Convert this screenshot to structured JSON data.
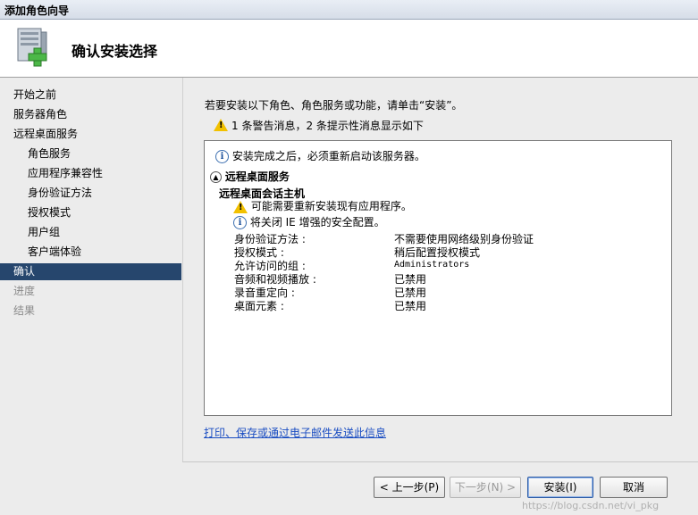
{
  "window": {
    "title": "添加角色向导"
  },
  "header": {
    "title": "确认安装选择",
    "icon": "server-add-icon"
  },
  "sidebar": {
    "items": [
      {
        "label": "开始之前",
        "level": 0,
        "state": "normal"
      },
      {
        "label": "服务器角色",
        "level": 0,
        "state": "normal"
      },
      {
        "label": "远程桌面服务",
        "level": 0,
        "state": "normal"
      },
      {
        "label": "角色服务",
        "level": 1,
        "state": "normal"
      },
      {
        "label": "应用程序兼容性",
        "level": 1,
        "state": "normal"
      },
      {
        "label": "身份验证方法",
        "level": 1,
        "state": "normal"
      },
      {
        "label": "授权模式",
        "level": 1,
        "state": "normal"
      },
      {
        "label": "用户组",
        "level": 1,
        "state": "normal"
      },
      {
        "label": "客户端体验",
        "level": 1,
        "state": "normal"
      },
      {
        "label": "确认",
        "level": 0,
        "state": "active"
      },
      {
        "label": "进度",
        "level": 0,
        "state": "disabled"
      },
      {
        "label": "结果",
        "level": 0,
        "state": "disabled"
      }
    ]
  },
  "main": {
    "intro": "若要安装以下角色、角色服务或功能，请单击“安装”。",
    "summary": "1 条警告消息，2 条提示性消息显示如下",
    "results": {
      "restart_info": "安装完成之后，必须重新启动该服务器。",
      "section_title": "远程桌面服务",
      "subsection_title": "远程桌面会话主机",
      "warning": "可能需要重新安装现有应用程序。",
      "ie_info": "将关闭 IE 增强的安全配置。",
      "settings": [
        {
          "key": "身份验证方法 :",
          "value": "不需要使用网络级别身份验证"
        },
        {
          "key": "授权模式 :",
          "value": "稍后配置授权模式"
        },
        {
          "key": "允许访问的组 :",
          "value": "Administrators"
        },
        {
          "key": "音频和视频播放 :",
          "value": "已禁用"
        },
        {
          "key": "录音重定向 :",
          "value": "已禁用"
        },
        {
          "key": "桌面元素 :",
          "value": "已禁用"
        }
      ]
    },
    "link": "打印、保存或通过电子邮件发送此信息"
  },
  "buttons": {
    "previous": "< 上一步(P)",
    "next": "下一步(N) >",
    "install": "安装(I)",
    "cancel": "取消"
  },
  "watermark": "https://blog.csdn.net/vi_pkg"
}
